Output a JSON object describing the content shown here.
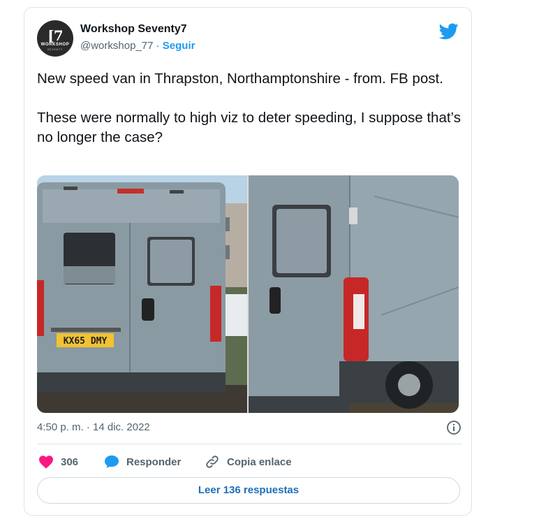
{
  "tweet": {
    "author": {
      "display_name": "Workshop Seventy7",
      "handle": "@workshop_77",
      "separator": "·",
      "follow_label": "Seguir",
      "avatar_mark": "[7",
      "avatar_text": "WORKSHOP",
      "avatar_subtext": "SEVENTY"
    },
    "text": "New speed van in Thrapston, Northamptonshire - from. FB post.\n\nThese were normally to high viz to deter speeding, I suppose that’s no longer the case?",
    "photos": [
      {
        "description_icon": "van-rear-photo",
        "plate": "KX65 DMY"
      },
      {
        "description_icon": "van-side-photo"
      }
    ],
    "timestamp": "4:50 p. m. · 14 dic. 2022",
    "actions": {
      "like_count": "306",
      "reply_label": "Responder",
      "copy_label": "Copia enlace"
    },
    "read_replies_label": "Leer 136 respuestas"
  },
  "colors": {
    "twitter_blue": "#1d9bf0",
    "like_pink": "#f91880",
    "text_secondary": "#536471"
  }
}
